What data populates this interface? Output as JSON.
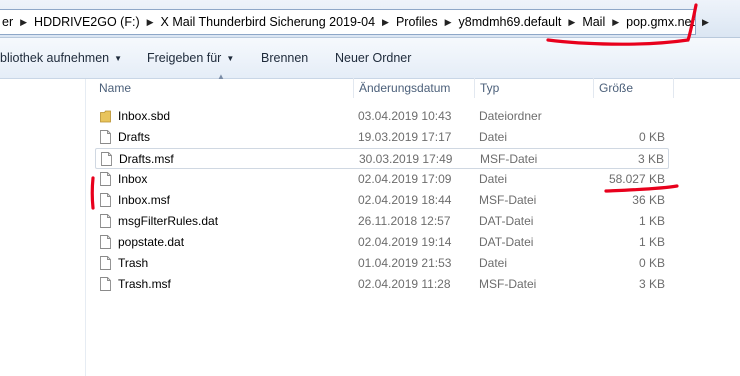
{
  "breadcrumb": [
    "er",
    "HDDRIVE2GO (F:)",
    "X Mail Thunderbird Sicherung 2019-04",
    "Profiles",
    "y8mdmh69.default",
    "Mail",
    "pop.gmx.net"
  ],
  "toolbar": {
    "library_label": "bliothek aufnehmen",
    "share_label": "Freigeben für",
    "burn_label": "Brennen",
    "new_folder_label": "Neuer Ordner"
  },
  "columns": {
    "name": "Name",
    "date": "Änderungsdatum",
    "type": "Typ",
    "size": "Größe"
  },
  "files": [
    {
      "name": "Inbox.sbd",
      "date": "03.04.2019 10:43",
      "type": "Dateiordner",
      "size": "",
      "icon": "folder-icon"
    },
    {
      "name": "Drafts",
      "date": "19.03.2019 17:17",
      "type": "Datei",
      "size": "0 KB",
      "icon": "file-icon"
    },
    {
      "name": "Drafts.msf",
      "date": "30.03.2019 17:49",
      "type": "MSF-Datei",
      "size": "3 KB",
      "icon": "file-icon"
    },
    {
      "name": "Inbox",
      "date": "02.04.2019 17:09",
      "type": "Datei",
      "size": "58.027 KB",
      "icon": "file-icon"
    },
    {
      "name": "Inbox.msf",
      "date": "02.04.2019 18:44",
      "type": "MSF-Datei",
      "size": "36 KB",
      "icon": "file-icon"
    },
    {
      "name": "msgFilterRules.dat",
      "date": "26.11.2018 12:57",
      "type": "DAT-Datei",
      "size": "1 KB",
      "icon": "file-icon"
    },
    {
      "name": "popstate.dat",
      "date": "02.04.2019 19:14",
      "type": "DAT-Datei",
      "size": "1 KB",
      "icon": "file-icon"
    },
    {
      "name": "Trash",
      "date": "01.04.2019 21:53",
      "type": "Datei",
      "size": "0 KB",
      "icon": "file-icon"
    },
    {
      "name": "Trash.msf",
      "date": "02.04.2019 11:28",
      "type": "MSF-Datei",
      "size": "3 KB",
      "icon": "file-icon"
    }
  ],
  "annotation_color": "#e8001c",
  "folder_color": "#e8c45c"
}
